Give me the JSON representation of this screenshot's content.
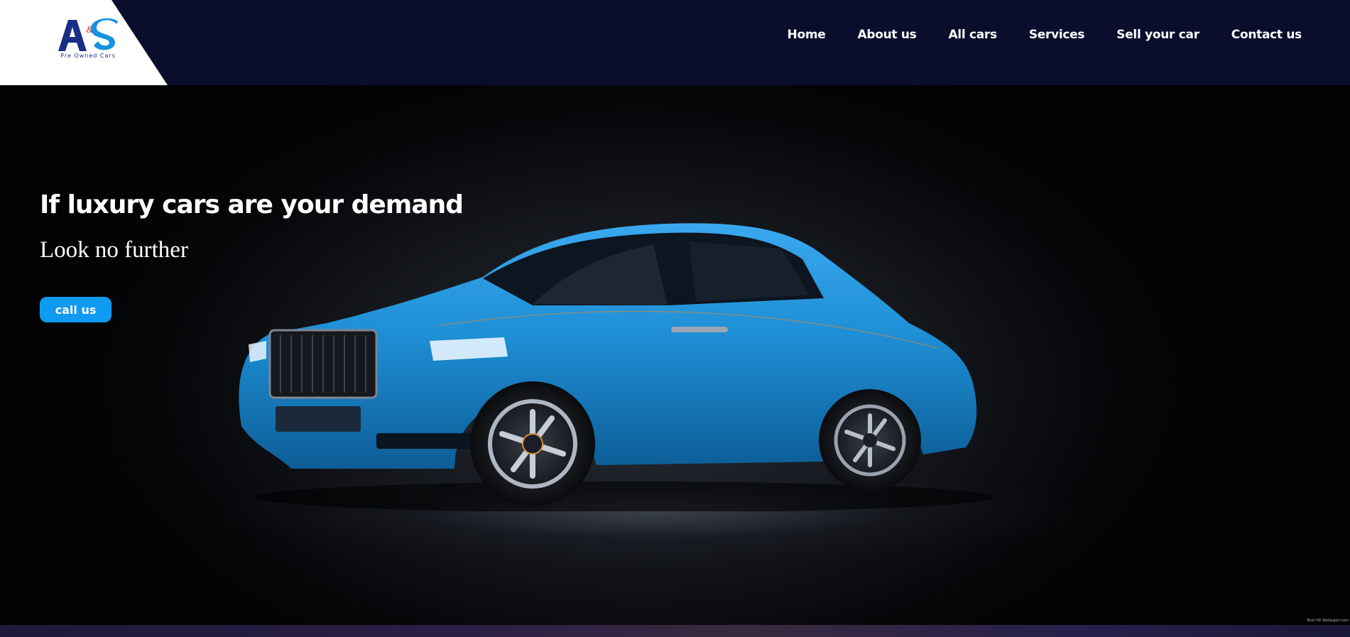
{
  "brand": {
    "logo_letters": "A&S",
    "tagline": "Pre Owned Cars",
    "colors": {
      "primary": "#1a2e86",
      "accent": "#0f9bf2",
      "amp": "#d6302b"
    }
  },
  "nav": {
    "items": [
      {
        "label": "Home"
      },
      {
        "label": "About us"
      },
      {
        "label": "All cars"
      },
      {
        "label": "Services"
      },
      {
        "label": "Sell your car"
      },
      {
        "label": "Contact us"
      }
    ]
  },
  "hero": {
    "title": "If luxury cars are your demand",
    "subtitle": "Look no further",
    "cta_label": "call us",
    "watermark": "Best HD Wallpaper.com",
    "image": "blue-luxury-coupe"
  },
  "theme": {
    "header_bg": "#0b0d2c",
    "hero_bg": "#050608",
    "car_color": "#1e8fd6"
  }
}
